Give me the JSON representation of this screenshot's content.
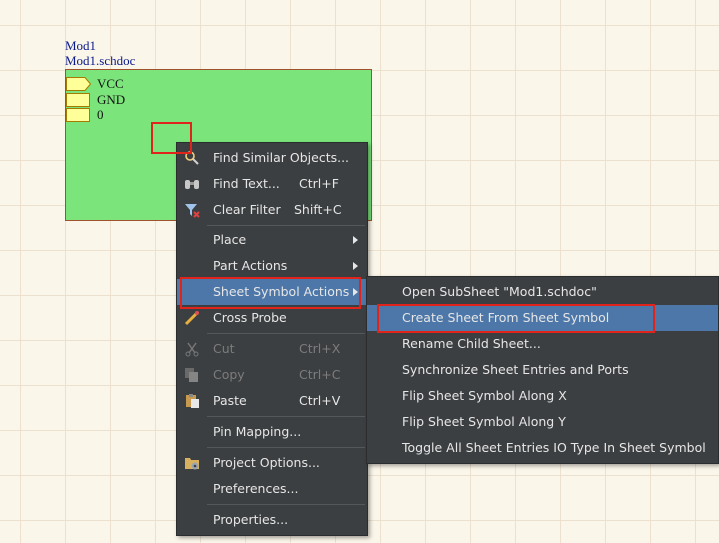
{
  "schematic": {
    "designator": "Mod1",
    "filename": "Mod1.schdoc",
    "entries": [
      "VCC",
      "GND",
      "0"
    ]
  },
  "context_menu": {
    "items": [
      {
        "label": "Find Similar Objects...",
        "icon": "find-similar-icon"
      },
      {
        "label": "Find Text...",
        "shortcut": "Ctrl+F",
        "icon": "binoculars-icon"
      },
      {
        "label": "Clear Filter",
        "shortcut": "Shift+C",
        "icon": "clear-filter-icon"
      },
      {
        "label": "Place",
        "has_submenu": true
      },
      {
        "label": "Part Actions",
        "has_submenu": true
      },
      {
        "label": "Sheet Symbol Actions",
        "has_submenu": true,
        "state": "highlighted"
      },
      {
        "label": "Cross Probe",
        "icon": "cross-probe-icon"
      },
      {
        "label": "Cut",
        "shortcut": "Ctrl+X",
        "icon": "scissors-icon",
        "state": "disabled"
      },
      {
        "label": "Copy",
        "shortcut": "Ctrl+C",
        "icon": "copy-icon",
        "state": "disabled"
      },
      {
        "label": "Paste",
        "shortcut": "Ctrl+V",
        "icon": "paste-icon"
      },
      {
        "label": "Pin Mapping..."
      },
      {
        "label": "Project Options...",
        "icon": "project-options-icon"
      },
      {
        "label": "Preferences..."
      },
      {
        "label": "Properties..."
      }
    ]
  },
  "submenu": {
    "items": [
      {
        "label": "Open SubSheet \"Mod1.schdoc\""
      },
      {
        "label": "Create Sheet From Sheet Symbol",
        "state": "highlighted"
      },
      {
        "label": "Rename Child Sheet..."
      },
      {
        "label": "Synchronize Sheet Entries and Ports"
      },
      {
        "label": "Flip Sheet Symbol Along X"
      },
      {
        "label": "Flip Sheet Symbol Along Y"
      },
      {
        "label": "Toggle All Sheet Entries IO Type In Sheet Symbol"
      }
    ]
  },
  "colors": {
    "sheet_fill": "#7be57b",
    "sheet_border": "#a0522d",
    "menu_bg": "#3c3f41",
    "highlight": "#4d77a8",
    "annotation": "#e0241b",
    "port_fill": "#ffff99",
    "port_border": "#a57a00"
  }
}
